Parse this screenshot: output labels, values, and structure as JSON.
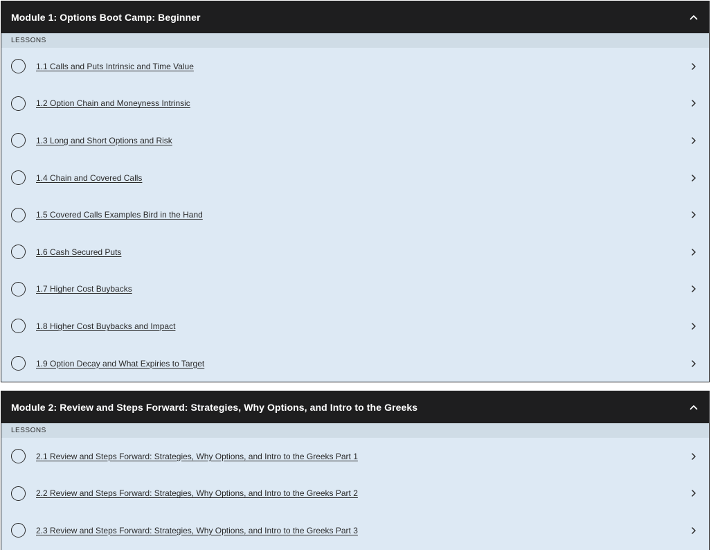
{
  "modules": [
    {
      "title": "Module 1: Options Boot Camp: Beginner",
      "lessons_label": "LESSONS",
      "lessons": [
        "1.1 Calls and Puts Intrinsic and Time Value",
        "1.2 Option Chain and Moneyness Intrinsic",
        "1.3 Long and Short Options and Risk",
        "1.4 Chain and Covered Calls",
        "1.5 Covered Calls Examples Bird in the Hand",
        "1.6 Cash Secured Puts",
        "1.7 Higher Cost Buybacks",
        "1.8 Higher Cost Buybacks and Impact",
        "1.9 Option Decay and What Expiries to Target"
      ]
    },
    {
      "title": "Module 2: Review and Steps Forward: Strategies, Why Options, and Intro to the Greeks",
      "lessons_label": "LESSONS",
      "lessons": [
        "2.1 Review and Steps Forward: Strategies, Why Options, and Intro to the Greeks Part 1",
        "2.2 Review and Steps Forward: Strategies, Why Options, and Intro to the Greeks Part 2",
        "2.3 Review and Steps Forward: Strategies, Why Options, and Intro to the Greeks Part 3"
      ]
    }
  ],
  "icons": {
    "collapse": "chevron-up-icon",
    "lesson_open": "chevron-right-icon",
    "lesson_status": "circle-icon"
  },
  "colors": {
    "header_bg": "#1e1e1f",
    "panel_bg": "#dde9f4",
    "lessons_label_bg": "#cfdce6"
  }
}
